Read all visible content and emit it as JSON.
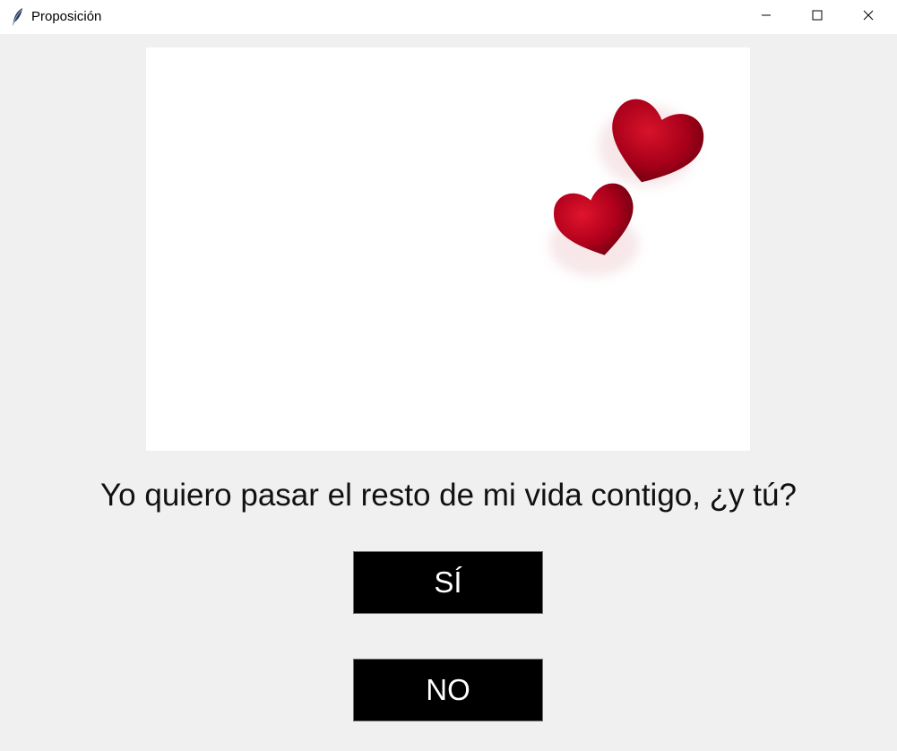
{
  "window": {
    "title": "Proposición",
    "icon": "feather-icon"
  },
  "image": {
    "subject": "two-red-hearts"
  },
  "question": {
    "text": "Yo quiero pasar el resto de mi vida contigo, ¿y tú?"
  },
  "buttons": {
    "yes_label": "SÍ",
    "no_label": "NO",
    "background": "#000000",
    "text_color": "#ffffff"
  },
  "colors": {
    "window_bg": "#f0f0f0",
    "titlebar_bg": "#ffffff",
    "heart_red": "#c0001a"
  }
}
